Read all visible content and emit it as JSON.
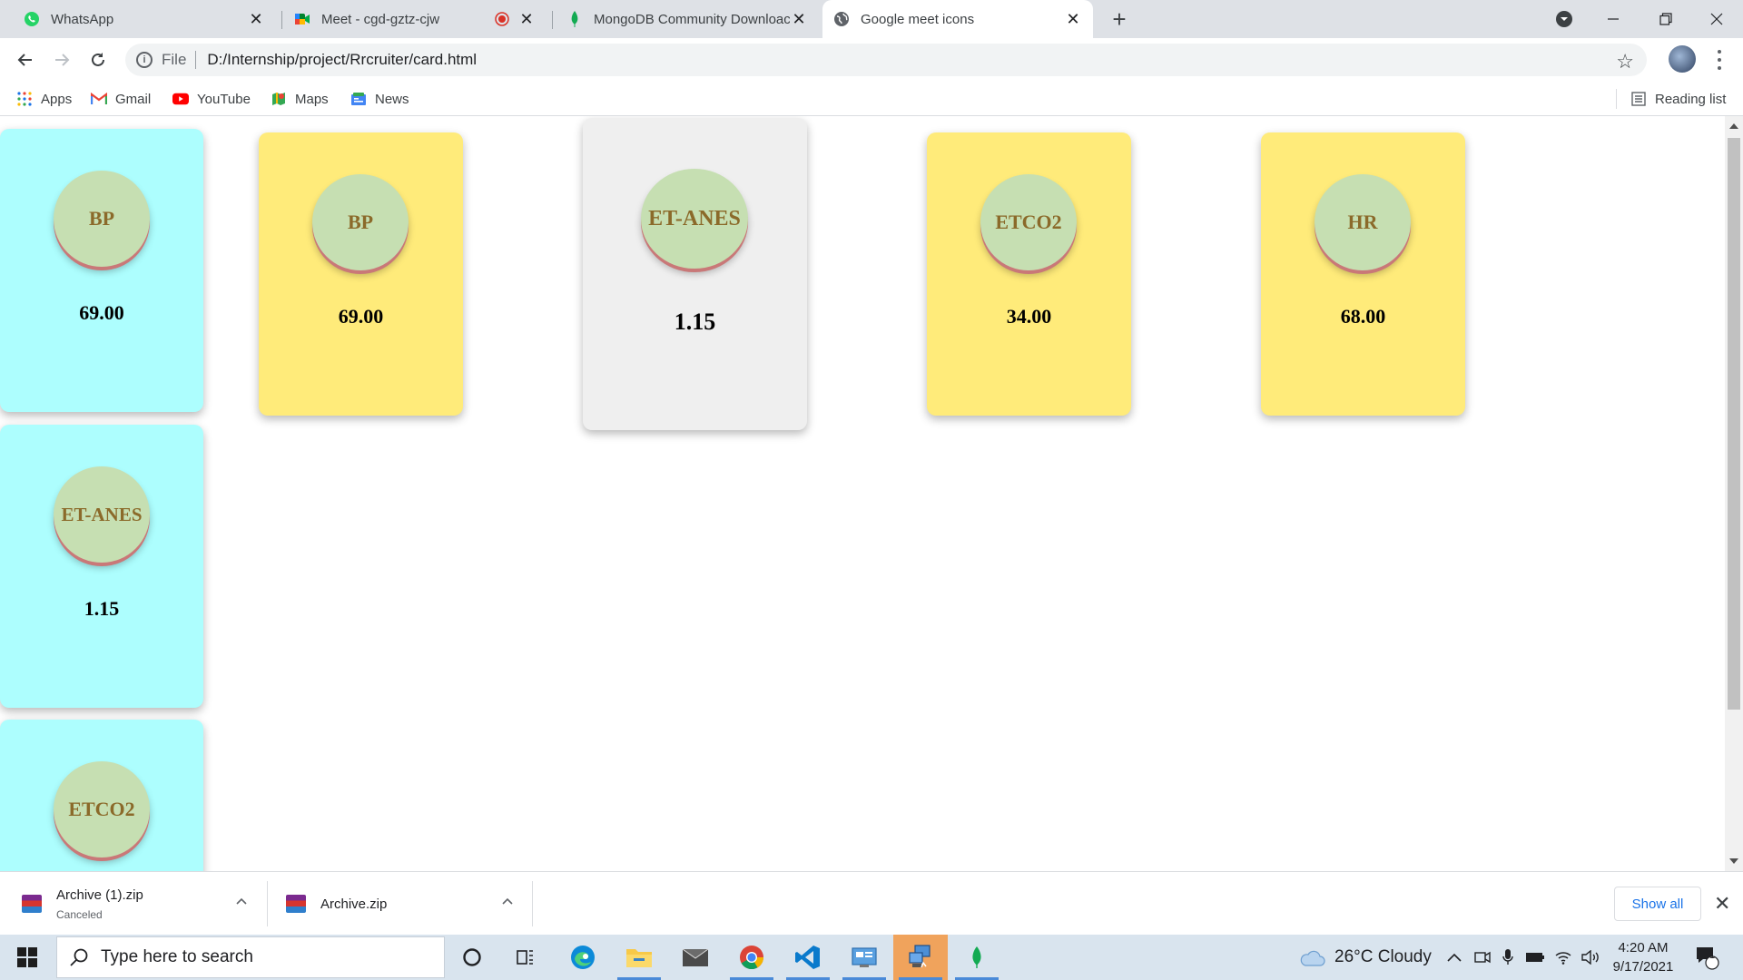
{
  "browser": {
    "tabs": [
      {
        "title": "WhatsApp",
        "icon": "whatsapp-icon"
      },
      {
        "title": "Meet - cgd-gztz-cjw",
        "icon": "google-meet-icon",
        "recording": true
      },
      {
        "title": "MongoDB Community Downloac",
        "icon": "mongodb-leaf-icon"
      },
      {
        "title": "Google meet icons",
        "icon": "globe-icon",
        "active": true
      }
    ],
    "url_scheme": "File",
    "url": "D:/Internship/project/Rrcruiter/card.html",
    "bookmarks": [
      {
        "label": "Apps",
        "icon": "apps-grid-icon"
      },
      {
        "label": "Gmail",
        "icon": "gmail-icon"
      },
      {
        "label": "YouTube",
        "icon": "youtube-icon"
      },
      {
        "label": "Maps",
        "icon": "maps-icon"
      },
      {
        "label": "News",
        "icon": "news-icon"
      }
    ],
    "reading_list": "Reading list"
  },
  "page": {
    "cards": [
      {
        "label": "BP",
        "value": "69.00",
        "color": "#adfefe"
      },
      {
        "label": "BP",
        "value": "69.00",
        "color": "#ffeb7a"
      },
      {
        "label": "ET-ANES",
        "value": "1.15",
        "color": "#efefef"
      },
      {
        "label": "ETCO2",
        "value": "34.00",
        "color": "#ffeb7a"
      },
      {
        "label": "HR",
        "value": "68.00",
        "color": "#ffeb7a"
      },
      {
        "label": "ET-ANES",
        "value": "1.15",
        "color": "#adfefe"
      },
      {
        "label": "ETCO2",
        "value": "",
        "color": "#adfefe"
      }
    ]
  },
  "downloads": {
    "items": [
      {
        "name": "Archive (1).zip",
        "status": "Canceled"
      },
      {
        "name": "Archive.zip",
        "status": ""
      }
    ],
    "show_all": "Show all"
  },
  "taskbar": {
    "search_placeholder": "Type here to search",
    "weather": "26°C  Cloudy",
    "time": "4:20 AM",
    "date": "9/17/2021",
    "notification_count": "1"
  }
}
